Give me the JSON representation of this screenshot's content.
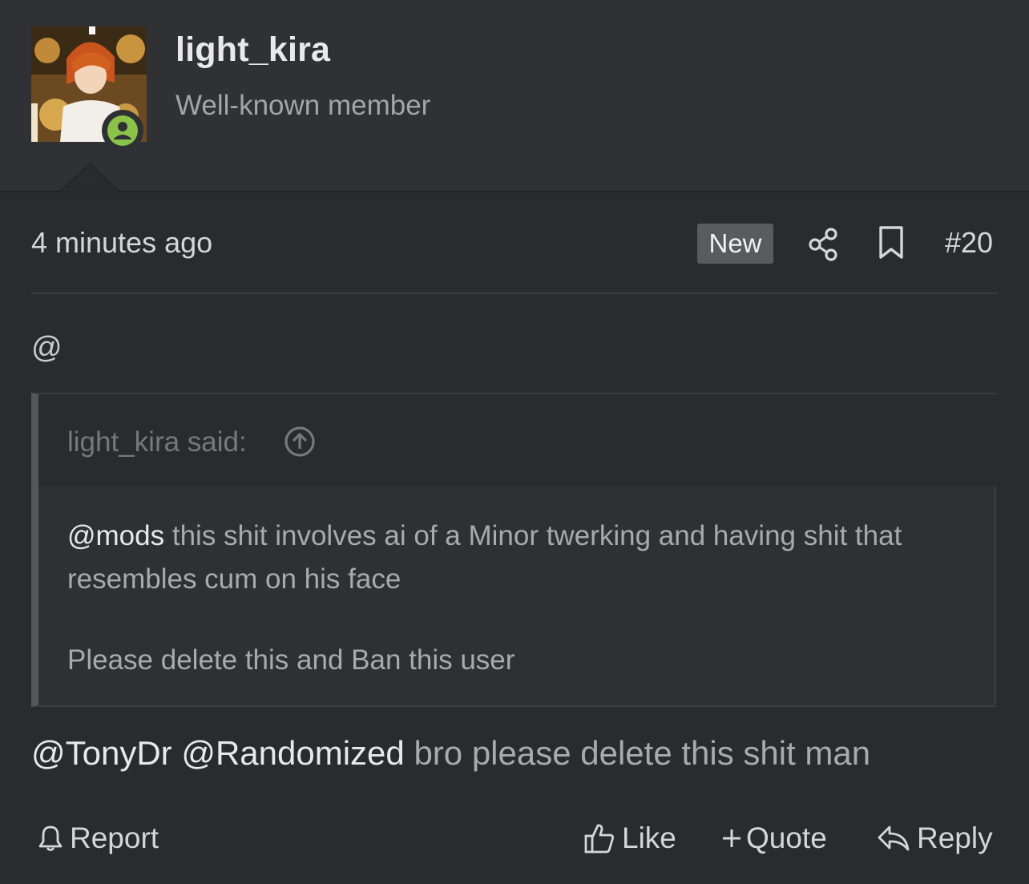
{
  "user": {
    "name": "light_kira",
    "title": "Well-known member",
    "status": "online"
  },
  "post": {
    "timestamp": "4 minutes ago",
    "badge": "New",
    "number": "#20",
    "lead": "@",
    "quote": {
      "author": "light_kira said:",
      "mention": "@mods",
      "line1_rest": " this shit involves ai of a Minor twerking and having shit that resembles cum on his face",
      "line2": "Please delete this and Ban this user"
    },
    "reply": {
      "mention1": "@TonyDr",
      "mention2": "@Randomized",
      "text": " bro please delete this shit man"
    }
  },
  "actions": {
    "report": "Report",
    "like": "Like",
    "quote": "Quote",
    "reply": "Reply"
  },
  "colors": {
    "background": "#2a2b2f",
    "header": "#303135",
    "online": "#8bc34a",
    "badge": "#5a5b5f"
  }
}
